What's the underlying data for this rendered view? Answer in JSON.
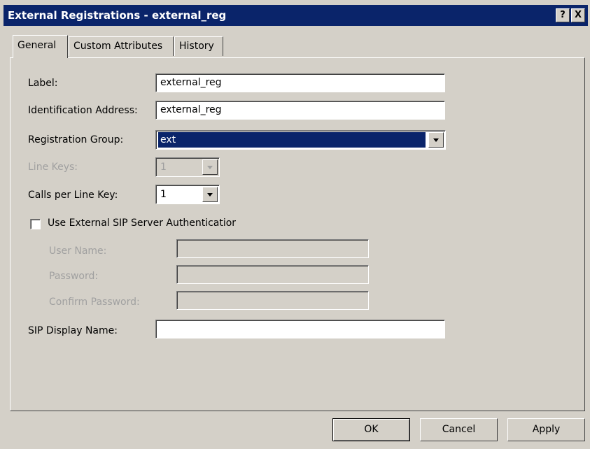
{
  "window": {
    "title": "External Registrations - external_reg"
  },
  "title_buttons": {
    "help": "?",
    "close": "X"
  },
  "tabs": [
    "General",
    "Custom Attributes",
    "History"
  ],
  "form": {
    "label": {
      "label": "Label:",
      "value": "external_reg"
    },
    "identification_address": {
      "label": "Identification Address:",
      "value": "external_reg"
    },
    "registration_group": {
      "label": "Registration Group:",
      "value": "ext"
    },
    "line_keys": {
      "label": "Line Keys:",
      "value": "1"
    },
    "calls_per_line_key": {
      "label": "Calls per Line Key:",
      "value": "1"
    },
    "use_external_auth": {
      "label": "Use External SIP Server Authenticatior",
      "checked": false
    },
    "user_name": {
      "label": "User Name:",
      "value": ""
    },
    "password": {
      "label": "Password:",
      "value": ""
    },
    "confirm_password": {
      "label": "Confirm Password:",
      "value": ""
    },
    "sip_display_name": {
      "label": "SIP Display Name:",
      "value": ""
    }
  },
  "buttons": {
    "ok": "OK",
    "cancel": "Cancel",
    "apply": "Apply"
  },
  "colors": {
    "titlebar": "#0a246a",
    "face": "#d4d0c8",
    "selection": "#0a246a"
  }
}
